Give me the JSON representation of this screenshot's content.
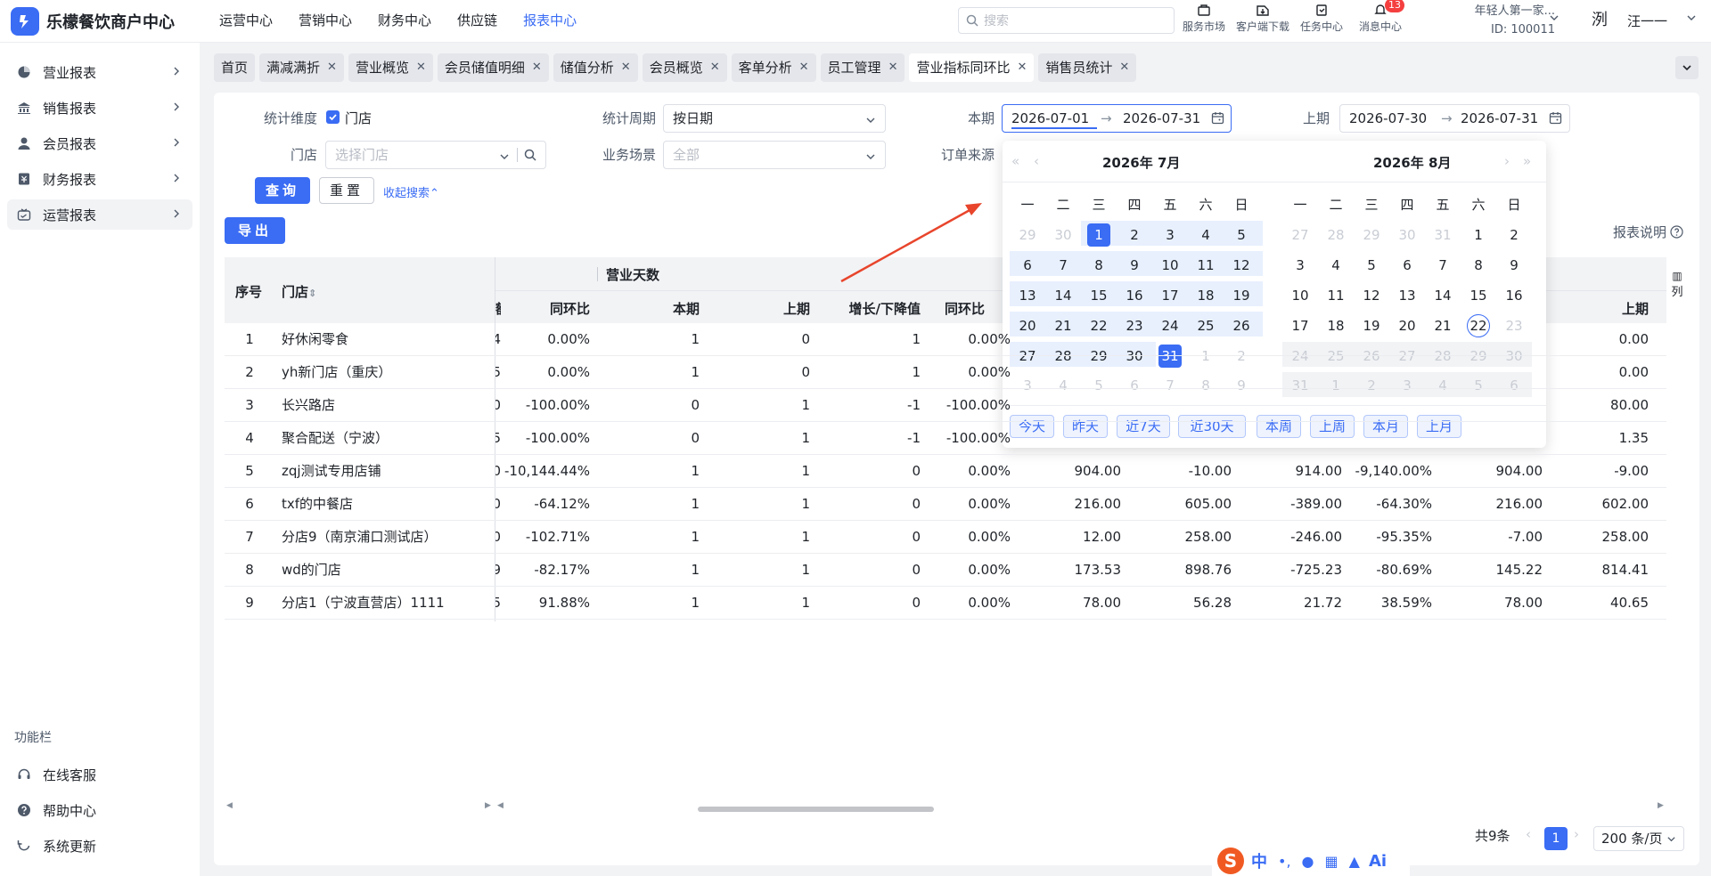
{
  "app": {
    "title": "乐檬餐饮商户中心"
  },
  "topnav": [
    "运营中心",
    "营销中心",
    "财务中心",
    "供应链",
    "报表中心"
  ],
  "search": {
    "placeholder": "搜索"
  },
  "topicons": [
    {
      "label": "服务市场",
      "icon": "shop-icon"
    },
    {
      "label": "客户端下载",
      "icon": "download-icon"
    },
    {
      "label": "任务中心",
      "icon": "clipboard-icon"
    },
    {
      "label": "消息中心",
      "icon": "bell-icon",
      "badge": "13"
    }
  ],
  "account": {
    "line1": "年轻人第一家...",
    "line2": "ID: 100011",
    "avatar": "洌",
    "username": "汪一一"
  },
  "sidebar": [
    {
      "label": "营业报表",
      "icon": "chart-icon"
    },
    {
      "label": "销售报表",
      "icon": "bank-icon"
    },
    {
      "label": "会员报表",
      "icon": "user-icon"
    },
    {
      "label": "财务报表",
      "icon": "finance-icon"
    },
    {
      "label": "运营报表",
      "icon": "ops-icon"
    }
  ],
  "sidebar_func": {
    "title": "功能栏",
    "items": [
      {
        "label": "在线客服",
        "icon": "headset-icon"
      },
      {
        "label": "帮助中心",
        "icon": "help-icon"
      },
      {
        "label": "系统更新",
        "icon": "refresh-icon"
      }
    ]
  },
  "tabs": [
    {
      "label": "首页",
      "close": false
    },
    {
      "label": "满减满折",
      "close": true
    },
    {
      "label": "营业概览",
      "close": true
    },
    {
      "label": "会员储值明细",
      "close": true
    },
    {
      "label": "储值分析",
      "close": true
    },
    {
      "label": "会员概览",
      "close": true
    },
    {
      "label": "客单分析",
      "close": true
    },
    {
      "label": "员工管理",
      "close": true
    },
    {
      "label": "营业指标同环比",
      "close": true,
      "active": true
    },
    {
      "label": "销售员统计",
      "close": true
    }
  ],
  "filters": {
    "dimension_label": "统计维度",
    "dimension_option": "门店",
    "store_label": "门店",
    "store_placeholder": "选择门店",
    "period_label": "统计周期",
    "period_value": "按日期",
    "scene_label": "业务场景",
    "scene_placeholder": "全部",
    "current_label": "本期",
    "current_start": "2026-07-01",
    "current_end": "2026-07-31",
    "previous_label": "上期",
    "previous_start": "2026-07-30",
    "previous_end": "2026-07-31",
    "source_label": "订单来源",
    "query": "查询",
    "reset": "重置",
    "collapse": "收起搜索"
  },
  "export": "导出",
  "report_help": "报表说明",
  "table": {
    "headers": {
      "index": "序号",
      "store": "门店",
      "group": "营业天数",
      "yoy": "同环比",
      "current": "本期",
      "previous": "上期",
      "change": "增长/下降值",
      "yoy2": "同环比",
      "previous_right": "上期",
      "columns_btn": "列"
    },
    "rows": [
      {
        "i": "1",
        "store": "好休闲零食",
        "p0": "4",
        "c0": "0.00%",
        "cur": "1",
        "prev": "0",
        "chg": "1",
        "yoy": "0.00%",
        "a": "",
        "b": "",
        "c": "",
        "d": "",
        "e": "",
        "f": "0.00"
      },
      {
        "i": "2",
        "store": "yh新门店（重庆）",
        "p0": "5",
        "c0": "0.00%",
        "cur": "1",
        "prev": "0",
        "chg": "1",
        "yoy": "0.00%",
        "a": "",
        "b": "",
        "c": "",
        "d": "",
        "e": "",
        "f": "0.00"
      },
      {
        "i": "3",
        "store": "长兴路店",
        "p0": "0",
        "c0": "-100.00%",
        "cur": "0",
        "prev": "1",
        "chg": "-1",
        "yoy": "-100.00%",
        "a": "",
        "b": "",
        "c": "",
        "d": "",
        "e": "",
        "f": "80.00"
      },
      {
        "i": "4",
        "store": "聚合配送（宁波）",
        "p0": "5",
        "c0": "-100.00%",
        "cur": "0",
        "prev": "1",
        "chg": "-1",
        "yoy": "-100.00%",
        "a": "",
        "b": "",
        "c": "",
        "d": "",
        "e": "",
        "f": "1.35"
      },
      {
        "i": "5",
        "store": "zqj测试专用店铺",
        "p0": "0",
        "c0": "-10,144.44%",
        "cur": "1",
        "prev": "1",
        "chg": "0",
        "yoy": "0.00%",
        "a": "904.00",
        "b": "-10.00",
        "c": "914.00",
        "d": "-9,140.00%",
        "e": "904.00",
        "f": "-9.00"
      },
      {
        "i": "6",
        "store": "txf的中餐店",
        "p0": "0",
        "c0": "-64.12%",
        "cur": "1",
        "prev": "1",
        "chg": "0",
        "yoy": "0.00%",
        "a": "216.00",
        "b": "605.00",
        "c": "-389.00",
        "d": "-64.30%",
        "e": "216.00",
        "f": "602.00"
      },
      {
        "i": "7",
        "store": "分店9（南京浦口测试店）",
        "p0": "0",
        "c0": "-102.71%",
        "cur": "1",
        "prev": "1",
        "chg": "0",
        "yoy": "0.00%",
        "a": "12.00",
        "b": "258.00",
        "c": "-246.00",
        "d": "-95.35%",
        "e": "-7.00",
        "f": "258.00"
      },
      {
        "i": "8",
        "store": "wd的门店",
        "p0": "9",
        "c0": "-82.17%",
        "cur": "1",
        "prev": "1",
        "chg": "0",
        "yoy": "0.00%",
        "a": "173.53",
        "b": "898.76",
        "c": "-725.23",
        "d": "-80.69%",
        "e": "145.22",
        "f": "814.41"
      },
      {
        "i": "9",
        "store": "分店1（宁波直营店）1111",
        "p0": "5",
        "c0": "91.88%",
        "cur": "1",
        "prev": "1",
        "chg": "0",
        "yoy": "0.00%",
        "a": "78.00",
        "b": "56.28",
        "c": "21.72",
        "d": "38.59%",
        "e": "78.00",
        "f": "40.65"
      }
    ]
  },
  "pager": {
    "total": "共9条",
    "current": "1",
    "size": "200 条/页"
  },
  "datepicker": {
    "left_title": "2026年  7月",
    "right_title": "2026年  8月",
    "weekdays": [
      "一",
      "二",
      "三",
      "四",
      "五",
      "六",
      "日"
    ],
    "left_days": [
      "29",
      "30",
      "1",
      "2",
      "3",
      "4",
      "5",
      "6",
      "7",
      "8",
      "9",
      "10",
      "11",
      "12",
      "13",
      "14",
      "15",
      "16",
      "17",
      "18",
      "19",
      "20",
      "21",
      "22",
      "23",
      "24",
      "25",
      "26",
      "27",
      "28",
      "29",
      "30",
      "31",
      "1",
      "2",
      "3",
      "4",
      "5",
      "6",
      "7",
      "8",
      "9"
    ],
    "right_days": [
      "27",
      "28",
      "29",
      "30",
      "31",
      "1",
      "2",
      "3",
      "4",
      "5",
      "6",
      "7",
      "8",
      "9",
      "10",
      "11",
      "12",
      "13",
      "14",
      "15",
      "16",
      "17",
      "18",
      "19",
      "20",
      "21",
      "22",
      "23",
      "24",
      "25",
      "26",
      "27",
      "28",
      "29",
      "30",
      "31",
      "1",
      "2",
      "3",
      "4",
      "5",
      "6"
    ],
    "quick": [
      "今天",
      "昨天",
      "近7天",
      "近30天",
      "本周",
      "上周",
      "本月",
      "上月"
    ]
  },
  "ime": {
    "label": "中"
  },
  "colors": {
    "primary": "#3a6cf4",
    "range": "#e8f0fe",
    "arrow": "#e8452c"
  }
}
